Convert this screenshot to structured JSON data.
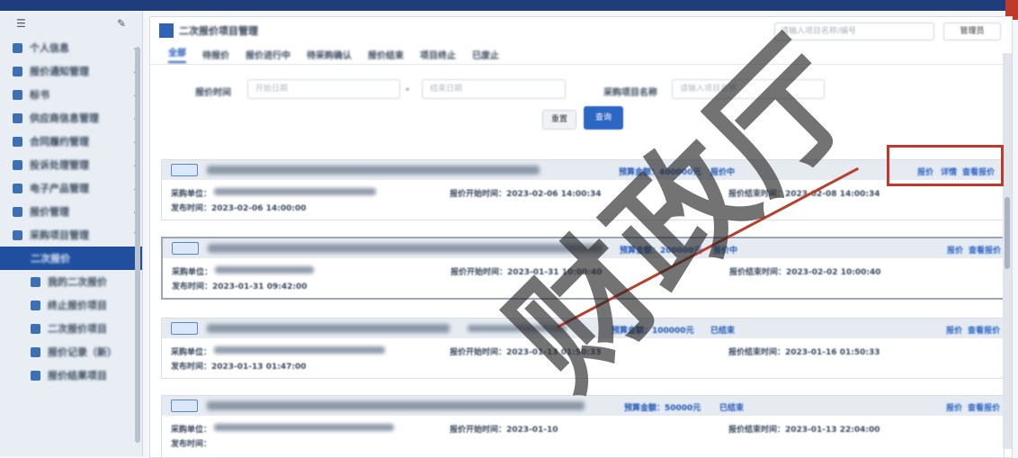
{
  "app": {
    "title": "二次报价项目管理",
    "search_placeholder": "请输入项目名称/编号",
    "user": "管理员"
  },
  "sidebar": {
    "items": [
      {
        "label": "个人信息",
        "icon": "user-icon"
      },
      {
        "label": "报价通知管理",
        "icon": "bell-icon"
      },
      {
        "label": "标书",
        "icon": "doc-icon"
      },
      {
        "label": "供应商信息管理",
        "icon": "building-icon"
      },
      {
        "label": "合同履约管理",
        "icon": "contract-icon"
      },
      {
        "label": "投诉处理管理",
        "icon": "complaint-icon"
      },
      {
        "label": "电子产品管理",
        "icon": "box-icon"
      },
      {
        "label": "报价管理",
        "icon": "tag-icon"
      },
      {
        "label": "采购项目管理",
        "icon": "folder-icon"
      }
    ],
    "active_item": "二次报价",
    "sub_items": [
      {
        "label": "我的二次报价",
        "icon": "list-icon"
      },
      {
        "label": "终止报价项目",
        "icon": "stop-icon"
      },
      {
        "label": "二次报价项目",
        "icon": "people-icon"
      },
      {
        "label": "报价记录（新）",
        "icon": "record-icon"
      },
      {
        "label": "报价结果项目",
        "icon": "result-icon"
      }
    ]
  },
  "tabs": [
    "全部",
    "待报价",
    "报价进行中",
    "待采购确认",
    "报价结束",
    "项目终止",
    "已废止"
  ],
  "filters": {
    "time_label": "报价时间",
    "start_placeholder": "开始日期",
    "end_placeholder": "结束日期",
    "name_label": "采购项目名称",
    "name_placeholder": "请输入项目名称",
    "reset": "重置",
    "query": "查询"
  },
  "cards": [
    {
      "status": "报价中",
      "budget": "预算金额：400000元",
      "dept_label": "采购单位：",
      "start": "报价开始时间：2023-02-06 14:00:34",
      "end": "报价结束时间：2023-02-08 14:00:34",
      "publish": "发布时间：2023-02-06 14:00:00",
      "actions": [
        "报价",
        "详情",
        "查看报价"
      ]
    },
    {
      "status": "报价中",
      "budget": "预算金额：200000元",
      "dept_label": "采购单位：",
      "start": "报价开始时间：2023-01-31 10:00:40",
      "end": "报价结束时间：2023-02-02 10:00:40",
      "publish": "发布时间：2023-01-31 09:42:00",
      "actions": [
        "报价",
        "查看报价"
      ]
    },
    {
      "status": "已结束",
      "budget": "预算金额：100000元",
      "dept_label": "采购单位：",
      "start": "报价开始时间：2023-01-13 01:50:33",
      "end": "报价结束时间：2023-01-16 01:50:33",
      "publish": "发布时间：2023-01-13 01:47:00",
      "actions": [
        "报价",
        "查看报价"
      ]
    },
    {
      "status": "已结束",
      "budget": "预算金额：50000元",
      "dept_label": "采购单位：",
      "start": "报价开始时间：2023-01-10",
      "end": "报价结束时间：2023-01-13 22:04:00",
      "publish": "发布时间：",
      "actions": [
        "报价",
        "查看报价"
      ]
    }
  ],
  "watermark": "财政厅"
}
